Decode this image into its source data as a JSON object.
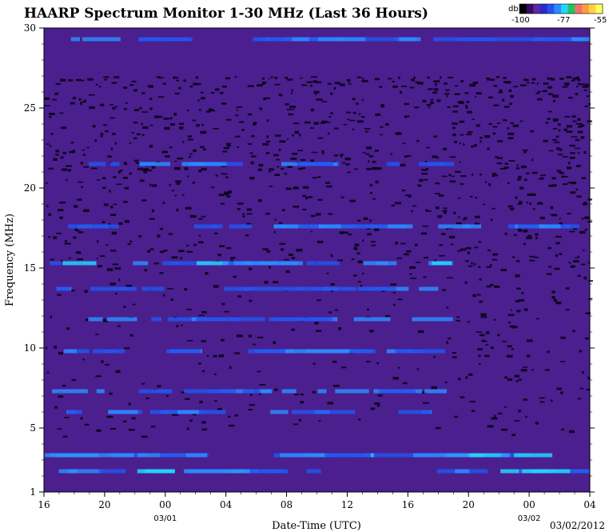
{
  "chart_data": {
    "type": "heatmap",
    "title": "HAARP Spectrum Monitor 1-30 MHz (Last 36 Hours)",
    "xlabel": "Date-Time (UTC)",
    "ylabel": "Frequency (MHz)",
    "ylim": [
      1,
      30
    ],
    "yticks": [
      "1",
      "5",
      "10",
      "15",
      "20",
      "25",
      "30"
    ],
    "yticks_values": [
      1,
      5,
      10,
      15,
      20,
      25,
      30
    ],
    "xticks": [
      "16",
      "20",
      "00",
      "04",
      "08",
      "12",
      "16",
      "20",
      "00",
      "04"
    ],
    "date_markers": [
      {
        "label": "03/01",
        "at_tick": 2
      },
      {
        "label": "03/02",
        "at_tick": 8
      }
    ],
    "end_date": "03/02/2012",
    "colorbar": {
      "unit": "db",
      "min_label": "-100",
      "mid_label": "-77",
      "max_label": "-55",
      "colors": [
        "#000000",
        "#3a0a6a",
        "#5a2a9e",
        "#2a2ad0",
        "#2255ee",
        "#2a8cff",
        "#22d4ff",
        "#22c45a",
        "#f07070",
        "#ff9a40",
        "#ffd040",
        "#ffff60"
      ]
    },
    "bands": [
      {
        "mhz": 2.3,
        "intensity": 0.7,
        "extent": "full"
      },
      {
        "mhz": 3.3,
        "intensity": 0.6,
        "extent": "full"
      },
      {
        "mhz": 6.0,
        "intensity": 0.55,
        "extent": "day"
      },
      {
        "mhz": 7.3,
        "intensity": 0.5,
        "extent": "day"
      },
      {
        "mhz": 9.8,
        "intensity": 0.5,
        "extent": "day"
      },
      {
        "mhz": 11.8,
        "intensity": 0.5,
        "extent": "day"
      },
      {
        "mhz": 13.7,
        "intensity": 0.45,
        "extent": "day"
      },
      {
        "mhz": 15.3,
        "intensity": 0.55,
        "extent": "day"
      },
      {
        "mhz": 17.6,
        "intensity": 0.5,
        "extent": "full"
      },
      {
        "mhz": 21.5,
        "intensity": 0.35,
        "extent": "day"
      },
      {
        "mhz": 29.3,
        "intensity": 0.5,
        "extent": "full"
      }
    ]
  }
}
